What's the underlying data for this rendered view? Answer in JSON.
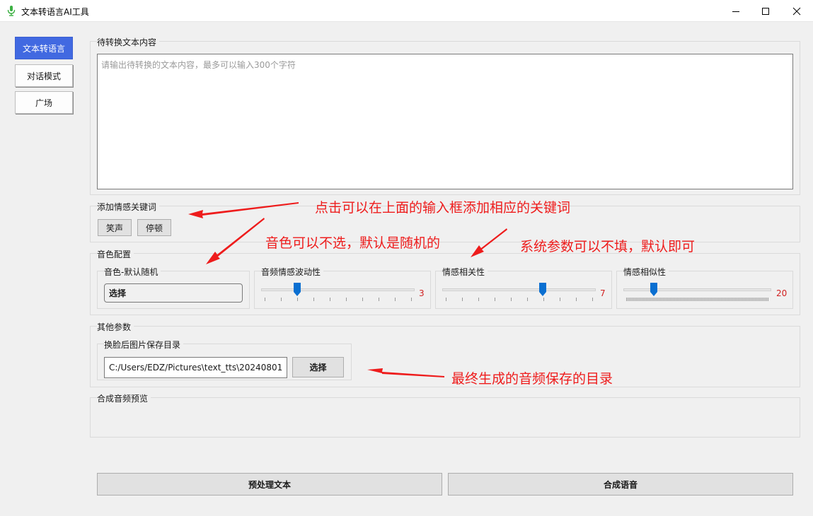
{
  "window": {
    "title": "文本转语言AI工具",
    "app_icon": "microphone-icon",
    "controls": [
      "minimize-icon",
      "maximize-icon",
      "close-icon"
    ]
  },
  "nav": {
    "items": [
      {
        "label": "文本转语言",
        "active": true
      },
      {
        "label": "对话模式",
        "active": false
      },
      {
        "label": "广场",
        "active": false
      }
    ]
  },
  "text_input": {
    "group_title": "待转换文本内容",
    "placeholder": "请输出待转换的文本内容，最多可以输入300个字符"
  },
  "keywords": {
    "group_title": "添加情感关键词",
    "buttons": [
      "笑声",
      "停顿"
    ]
  },
  "voice_config": {
    "group_title": "音色配置",
    "voice": {
      "title": "音色-默认随机",
      "button": "选择"
    },
    "sliders": [
      {
        "title": "音频情感波动性",
        "value": "3"
      },
      {
        "title": "情感相关性",
        "value": "7"
      },
      {
        "title": "情感相似性",
        "value": "20"
      }
    ]
  },
  "other_params": {
    "group_title": "其他参数",
    "save_dir": {
      "title": "换脸后图片保存目录",
      "value": "C:/Users/EDZ/Pictures\\text_tts\\20240801",
      "button": "选择"
    }
  },
  "preview": {
    "group_title": "合成音频预览"
  },
  "actions": {
    "preprocess": "预处理文本",
    "synthesize": "合成语音"
  },
  "annotations": {
    "keywords_note": "点击可以在上面的输入框添加相应的关键词",
    "voice_note": "音色可以不选，默认是随机的",
    "params_note": "系统参数可以不填，默认即可",
    "dir_note": "最终生成的音频保存的目录",
    "color": "#ee1c1c"
  },
  "colors": {
    "accent": "#4169e1",
    "slider_thumb": "#0a6fd1",
    "value_text": "#d12020"
  }
}
